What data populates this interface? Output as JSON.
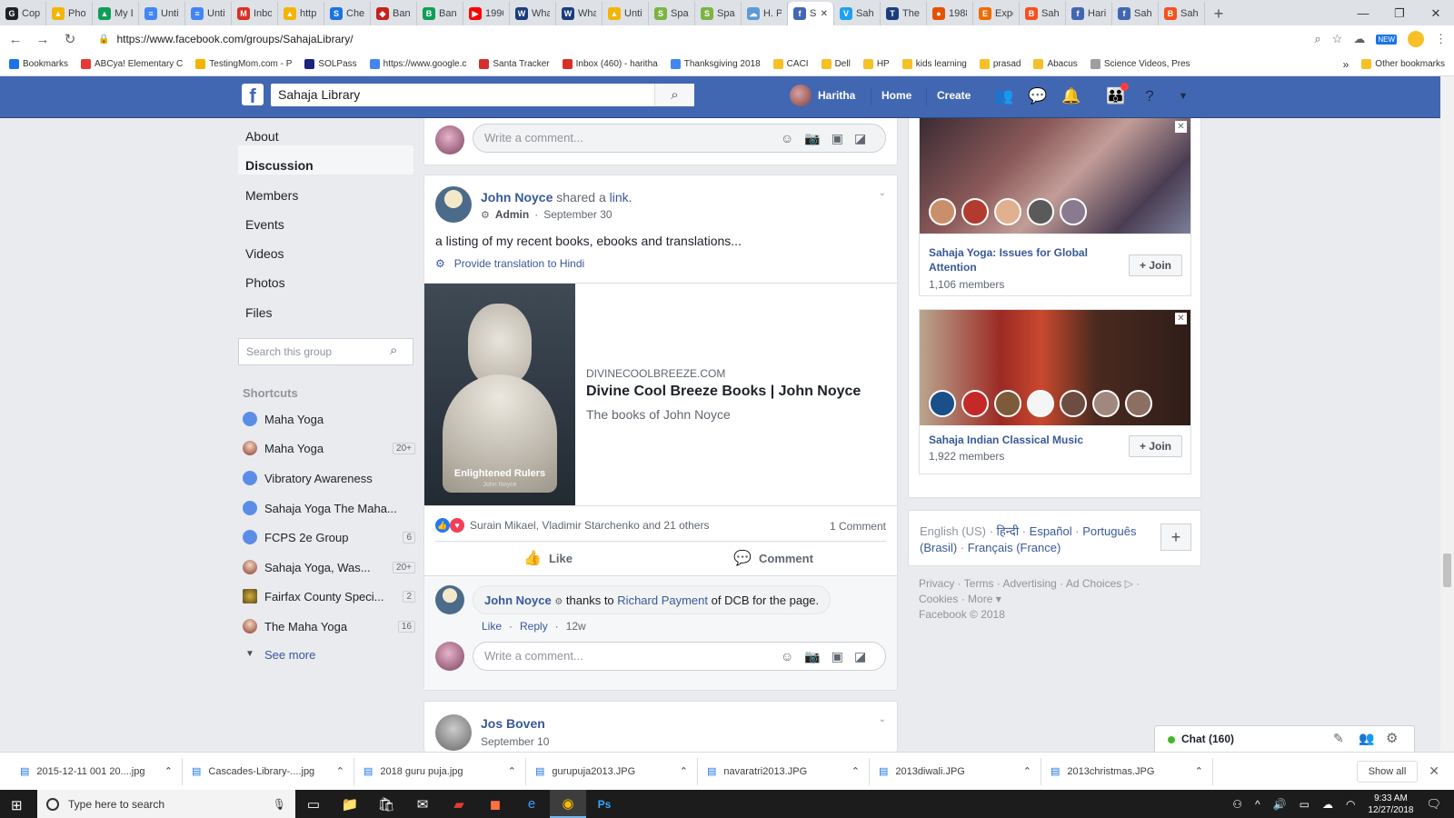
{
  "browser": {
    "tabs": [
      {
        "label": "Cop",
        "icon": "G",
        "color": "#202124"
      },
      {
        "label": "Phot",
        "icon": "▲",
        "color": "#f4b400"
      },
      {
        "label": "My D",
        "icon": "▲",
        "color": "#0f9d58"
      },
      {
        "label": "Untit",
        "icon": "≡",
        "color": "#4285f4"
      },
      {
        "label": "Untit",
        "icon": "≡",
        "color": "#4285f4"
      },
      {
        "label": "Inbo",
        "icon": "M",
        "color": "#d93025"
      },
      {
        "label": "http",
        "icon": "▲",
        "color": "#f4b400"
      },
      {
        "label": "Chec",
        "icon": "S",
        "color": "#1a73e8"
      },
      {
        "label": "Bank",
        "icon": "◆",
        "color": "#c5221f"
      },
      {
        "label": "Bann",
        "icon": "B",
        "color": "#0f9d58"
      },
      {
        "label": "1990",
        "icon": "▶",
        "color": "#ff0000"
      },
      {
        "label": "Wha",
        "icon": "W",
        "color": "#1a3d7c"
      },
      {
        "label": "Wha",
        "icon": "W",
        "color": "#1a3d7c"
      },
      {
        "label": "Untit",
        "icon": "▲",
        "color": "#f4b400"
      },
      {
        "label": "Spac",
        "icon": "S",
        "color": "#7cb342"
      },
      {
        "label": "Spac",
        "icon": "S",
        "color": "#7cb342"
      },
      {
        "label": "H. P.",
        "icon": "☁",
        "color": "#5b9bd5"
      },
      {
        "label": "S",
        "icon": "f",
        "color": "#4267b2",
        "active": true
      },
      {
        "label": "Saha",
        "icon": "V",
        "color": "#1da1f2"
      },
      {
        "label": "The",
        "icon": "T",
        "color": "#1a3d7c"
      },
      {
        "label": "1988",
        "icon": "●",
        "color": "#e65100"
      },
      {
        "label": "Expe",
        "icon": "E",
        "color": "#ef6c00"
      },
      {
        "label": "Saha",
        "icon": "B",
        "color": "#f4511e"
      },
      {
        "label": "Hari",
        "icon": "f",
        "color": "#4267b2"
      },
      {
        "label": "Saha",
        "icon": "f",
        "color": "#4267b2"
      },
      {
        "label": "Saha",
        "icon": "B",
        "color": "#f4511e"
      }
    ],
    "url": "https://www.facebook.com/groups/SahajaLibrary/",
    "bookmarks": [
      {
        "label": "Bookmarks",
        "color": "#1a73e8"
      },
      {
        "label": "ABCya! Elementary C",
        "color": "#e53935"
      },
      {
        "label": "TestingMom.com - P",
        "color": "#f4b400"
      },
      {
        "label": "SOLPass",
        "color": "#1a237e"
      },
      {
        "label": "https://www.google.c",
        "color": "#4285f4"
      },
      {
        "label": "Santa Tracker",
        "color": "#d32f2f"
      },
      {
        "label": "Inbox (460) - haritha",
        "color": "#d93025"
      },
      {
        "label": "Thanksgiving 2018",
        "color": "#4285f4"
      },
      {
        "label": "CACI",
        "color": "#f6c026"
      },
      {
        "label": "Dell",
        "color": "#f6c026"
      },
      {
        "label": "HP",
        "color": "#f6c026"
      },
      {
        "label": "kids learning",
        "color": "#f6c026"
      },
      {
        "label": "prasad",
        "color": "#f6c026"
      },
      {
        "label": "Abacus",
        "color": "#f6c026"
      },
      {
        "label": "Science Videos, Pres",
        "color": "#9e9e9e"
      }
    ],
    "bookmarks_more": "»",
    "other_bookmarks": "Other bookmarks"
  },
  "fb_header": {
    "logo": "f",
    "search_value": "Sahaja Library",
    "user": "Haritha",
    "home": "Home",
    "create": "Create"
  },
  "left_nav": {
    "items": [
      "About",
      "Discussion",
      "Members",
      "Events",
      "Videos",
      "Photos",
      "Files"
    ],
    "search_placeholder": "Search this group",
    "shortcuts_title": "Shortcuts",
    "shortcuts": [
      {
        "name": "Maha Yoga",
        "count": "",
        "kind": "group"
      },
      {
        "name": "Maha Yoga",
        "count": "20+",
        "kind": "photo"
      },
      {
        "name": "Vibratory Awareness",
        "count": "",
        "kind": "group"
      },
      {
        "name": "Sahaja Yoga The Maha...",
        "count": "",
        "kind": "group"
      },
      {
        "name": "FCPS 2e Group",
        "count": "6",
        "kind": "group"
      },
      {
        "name": "Sahaja Yoga, Was...",
        "count": "20+",
        "kind": "photo"
      },
      {
        "name": "Fairfax County Speci...",
        "count": "2",
        "kind": "seal"
      },
      {
        "name": "The Maha Yoga",
        "count": "16",
        "kind": "photo"
      }
    ],
    "see_more": "See more"
  },
  "feed": {
    "comment_placeholder": "Write a comment...",
    "post": {
      "author": "John Noyce",
      "action_prefix": "shared a",
      "action_link": "link.",
      "role": "Admin",
      "date": "September 30",
      "text": "a listing of my recent books, ebooks and translations...",
      "translate": "Provide translation to Hindi",
      "link_domain": "DIVINECOOLBREEZE.COM",
      "link_title": "Divine Cool Breeze Books | John Noyce",
      "link_desc": "The books of John Noyce",
      "image_caption": "Enlightened Rulers",
      "image_sub": "John Noyce",
      "reactions": "Surain Mikael, Vladimir Starchenko and 21 others",
      "comment_count": "1 Comment",
      "like": "Like",
      "comment": "Comment",
      "reply_author": "John Noyce",
      "reply_pre": "thanks to",
      "reply_link": "Richard Payment",
      "reply_post": "of DCB for the page.",
      "reply_like": "Like",
      "reply_reply": "Reply",
      "reply_time": "12w"
    },
    "next_post": {
      "author": "Jos Boven",
      "date": "September 10"
    }
  },
  "right_col": {
    "ads": [
      {
        "title": "Sahaja Yoga: Issues for Global Attention",
        "members": "1,106 members",
        "join": "Join"
      },
      {
        "title": "Sahaja Indian Classical Music",
        "members": "1,922 members",
        "join": "Join"
      }
    ],
    "languages": [
      "English (US)",
      "हिन्दी",
      "Español",
      "Português (Brasil)",
      "Français (France)"
    ],
    "footer_links": [
      "Privacy",
      "Terms",
      "Advertising",
      "Ad Choices",
      "Cookies",
      "More"
    ],
    "copyright": "Facebook © 2018"
  },
  "chat": {
    "label": "Chat (160)"
  },
  "downloads": {
    "files": [
      "2015-12-11 001 20....jpg",
      "Cascades-Library-....jpg",
      "2018 guru puja.jpg",
      "gurupuja2013.JPG",
      "navaratri2013.JPG",
      "2013diwali.JPG",
      "2013christmas.JPG"
    ],
    "show_all": "Show all"
  },
  "taskbar": {
    "search_placeholder": "Type here to search",
    "time": "9:33 AM",
    "date": "12/27/2018"
  }
}
